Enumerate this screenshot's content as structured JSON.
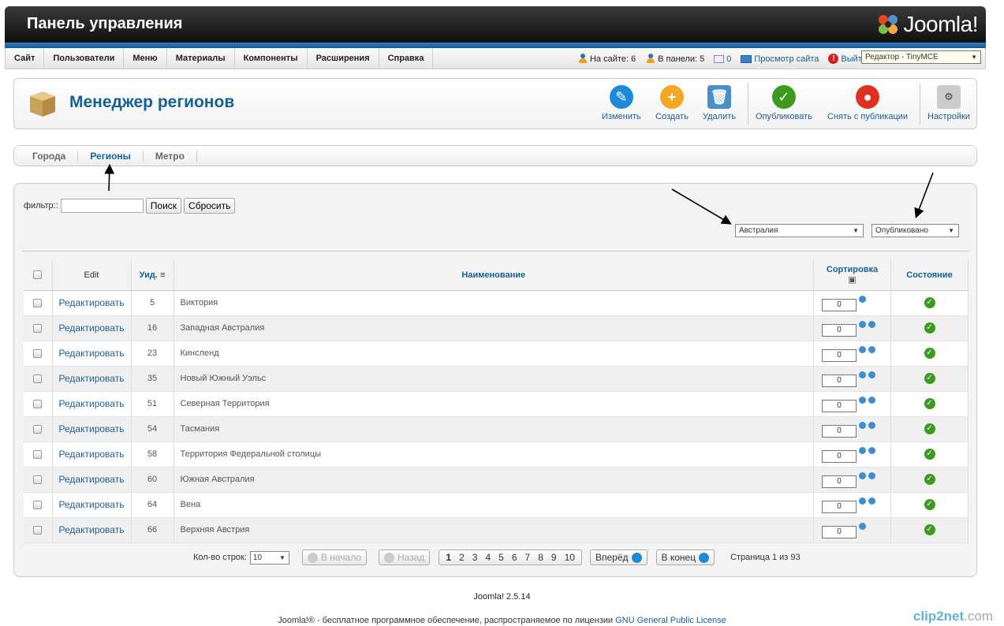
{
  "header": {
    "title": "Панель управления",
    "logo_text": "Joomla!"
  },
  "menu": [
    "Сайт",
    "Пользователи",
    "Меню",
    "Материалы",
    "Компоненты",
    "Расширения",
    "Справка"
  ],
  "status": {
    "on_site": "На сайте: 6",
    "in_panel": "В панели: 5",
    "messages": "0",
    "view_site": "Просмотр сайта",
    "logout": "Выйти",
    "editor": "Редактор - TinyMCE"
  },
  "toolbar": {
    "title": "Менеджер регионов",
    "edit": "Изменить",
    "create": "Создать",
    "delete": "Удалить",
    "publish": "Опубликовать",
    "unpublish": "Снять с публикации",
    "options": "Настройки"
  },
  "tabs": [
    "Города",
    "Регионы",
    "Метро"
  ],
  "filter": {
    "label": "фильтр::",
    "value": "",
    "search": "Поиск",
    "reset": "Сбросить",
    "country": "Австралия",
    "state": "Опубликовано"
  },
  "columns": {
    "edit": "Edit",
    "id": "Уид.",
    "name": "Наименование",
    "ordering": "Сортировка",
    "status": "Состояние"
  },
  "rows": [
    {
      "edit": "Редактировать",
      "id": "5",
      "name": "Виктория",
      "order": "0"
    },
    {
      "edit": "Редактировать",
      "id": "16",
      "name": "Западная Австралия",
      "order": "0"
    },
    {
      "edit": "Редактировать",
      "id": "23",
      "name": "Кинсленд",
      "order": "0"
    },
    {
      "edit": "Редактировать",
      "id": "35",
      "name": "Новый Южный Уэльс",
      "order": "0"
    },
    {
      "edit": "Редактировать",
      "id": "51",
      "name": "Северная Территория",
      "order": "0"
    },
    {
      "edit": "Редактировать",
      "id": "54",
      "name": "Тасмания",
      "order": "0"
    },
    {
      "edit": "Редактировать",
      "id": "58",
      "name": "Территория Федеральной столицы",
      "order": "0"
    },
    {
      "edit": "Редактировать",
      "id": "60",
      "name": "Южная Австралия",
      "order": "0"
    },
    {
      "edit": "Редактировать",
      "id": "64",
      "name": "Вена",
      "order": "0"
    },
    {
      "edit": "Редактировать",
      "id": "66",
      "name": "Верхняя Австрия",
      "order": "0"
    }
  ],
  "pager": {
    "rows_label": "Кол-во строк:",
    "rows_value": "10",
    "first": "В начало",
    "prev": "Назад",
    "pages": [
      "1",
      "2",
      "3",
      "4",
      "5",
      "6",
      "7",
      "8",
      "9",
      "10"
    ],
    "next": "Вперёд",
    "last": "В конец",
    "info": "Страница 1 из 93"
  },
  "footer": {
    "version": "Joomla! 2.5.14",
    "license_prefix": "Joomla!® - бесплатное программное обеспечение, распространяемое по лицензии ",
    "license_link": "GNU General Public License",
    "watermark": "clip2net",
    "watermark_suffix": ".com"
  }
}
